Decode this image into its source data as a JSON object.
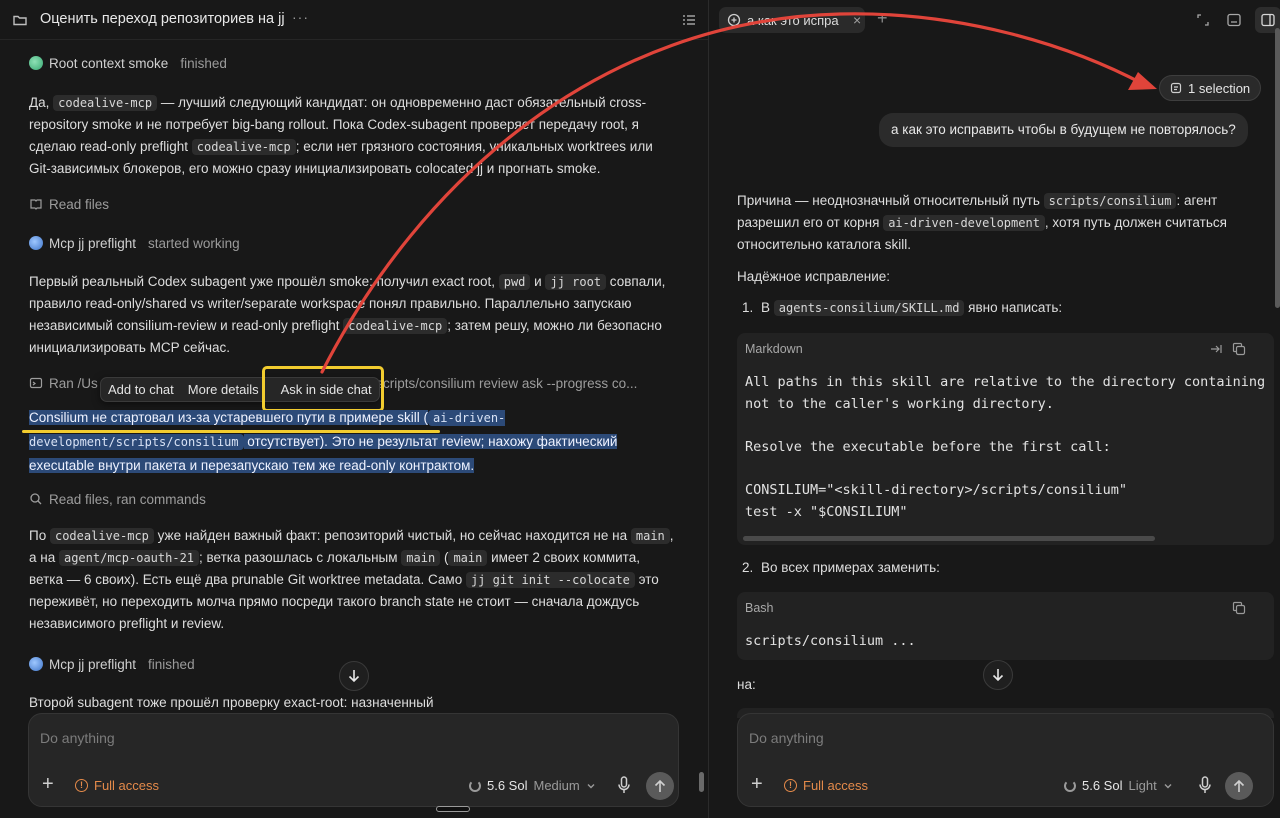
{
  "left": {
    "header": {
      "title": "Оценить переход репозиториев на jj",
      "more": "···"
    },
    "status1": {
      "agent": "Root context smoke",
      "state": "finished"
    },
    "para1": {
      "t1": "Да, ",
      "c1": "codealive-mcp",
      "t2": " — лучший следующий кандидат: он одновременно даст обязательный cross-repository smoke и не потребует big-bang rollout. Пока Codex-subagent проверяет передачу root, я сделаю read-only preflight ",
      "c2": "codealive-mcp",
      "t3": "; если нет грязного состояния, уникальных worktrees или Git-зависимых блокеров, его можно сразу инициализировать colocated jj и прогнать smoke."
    },
    "tool1": "Read files",
    "status2": {
      "agent": "Mcp jj preflight",
      "state": "started working"
    },
    "para2": {
      "t1": "Первый реальный Codex subagent уже прошёл smoke: получил exact root, ",
      "c1": "pwd",
      "t2": " и ",
      "c2": "jj root",
      "t3": " совпали, правило read-only/shared vs writer/separate workspace понял правильно. Параллельно запускаю независимый consilium-review и read-only preflight ",
      "c3": "codealive-mcp",
      "t4": "; затем решу, можно ли безопасно инициализировать MCP сейчас."
    },
    "tool2": {
      "prefix": "Ran /Us",
      "suffix": "t/scripts/consilium review ask --progress co..."
    },
    "popup": {
      "add_to_chat": "Add to chat",
      "more_details": "More details",
      "ask_side": "Ask in side chat"
    },
    "para3": {
      "t1": "Consilium не стартовал из-за устаревшего пути в примере skill (",
      "c1": "ai-driven-development/scripts/consilium",
      "t2": " отсутствует). Это не результат review; нахожу фактический executable внутри пакета и перезапускаю тем же read-only контрактом."
    },
    "tool3": "Read files, ran commands",
    "para4": {
      "t1": "По ",
      "c1": "codealive-mcp",
      "t2": " уже найден важный факт: репозиторий чистый, но сейчас находится не на ",
      "c2": "main",
      "t3": ", а на ",
      "c3": "agent/mcp-oauth-21",
      "t4": "; ветка разошлась с локальным ",
      "c4": "main",
      "t5": " (",
      "c5": "main",
      "t6": " имеет 2 своих коммита, ветка — 6 своих). Есть ещё два prunable Git worktree metadata. Само ",
      "c6": "jj git init --colocate",
      "t7": " это переживёт, но переходить молча прямо посреди такого branch state не стоит — сначала дождусь независимого preflight и review."
    },
    "status3": {
      "agent": "Mcp jj preflight",
      "state": "finished"
    },
    "para5": "Второй subagent тоже прошёл проверку exact-root: назначенный",
    "composer": {
      "placeholder": "Do anything",
      "access": "Full access",
      "model": "5.6 Sol",
      "effort": "Medium"
    }
  },
  "right": {
    "tab": {
      "title": "а как это испра",
      "close": "×",
      "add": "+"
    },
    "selection": "1 selection",
    "user_message": "а как это исправить чтобы в будущем не повторялось?",
    "p1": {
      "t1": "Причина — неоднозначный относительный путь ",
      "c1": "scripts/consilium",
      "t2": ": агент разрешил его от корня ",
      "c2": "ai-driven-development",
      "t3": ", хотя путь должен считаться относительно каталога skill."
    },
    "p2": "Надёжное исправление:",
    "li1": {
      "num": "1.",
      "t1": "В ",
      "c1": "agents-consilium/SKILL.md",
      "t2": " явно написать:"
    },
    "code1": {
      "lang": "Markdown",
      "text": "All paths in this skill are relative to the directory containing\nnot to the caller's working directory.\n\nResolve the executable before the first call:\n\nCONSILIUM=\"<skill-directory>/scripts/consilium\"\ntest -x \"$CONSILIUM\""
    },
    "li2": {
      "num": "2.",
      "t1": "Во всех примерах заменить:"
    },
    "code2": {
      "lang": "Bash",
      "text": "scripts/consilium ..."
    },
    "na": "на:",
    "composer": {
      "placeholder": "Do anything",
      "access": "Full access",
      "model": "5.6 Sol",
      "effort": "Light"
    }
  },
  "colors": {
    "background": "#181818",
    "selection": "#2c4a78",
    "annotation_yellow": "#f2cc2f",
    "annotation_red": "#e0443a",
    "access_orange": "#e48a4a"
  }
}
